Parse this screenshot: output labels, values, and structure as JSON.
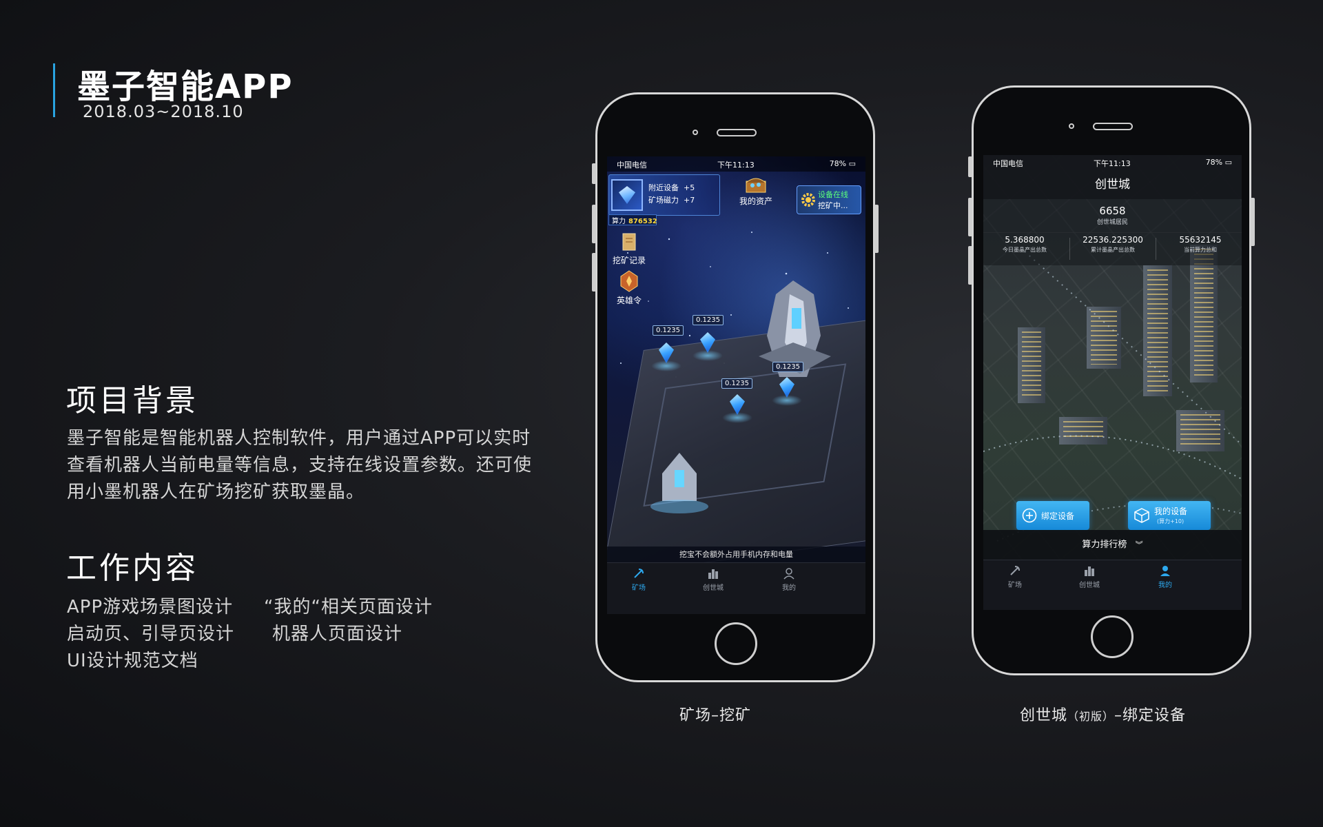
{
  "header": {
    "title": "墨子智能APP",
    "date": "2018.03~2018.10"
  },
  "background": {
    "title": "项目背景",
    "lines": [
      "墨子智能是智能机器人控制软件，用户通过APP可以实时",
      "查看机器人当前电量等信息，支持在线设置参数。还可使",
      "用小墨机器人在矿场挖矿获取墨晶。"
    ]
  },
  "work": {
    "title": "工作内容",
    "col1": [
      "APP游戏场景图设计",
      "启动页、引导页设计",
      "UI设计规范文档"
    ],
    "col2": [
      "“我的“相关页面设计",
      "机器人页面设计"
    ]
  },
  "phone1": {
    "caption": "矿场–挖矿",
    "status": {
      "carrier": "中国电信",
      "time": "下午11:13",
      "battery": "78%"
    },
    "hud": {
      "nearby": "附近设备",
      "nearby_val": "+5",
      "magnet": "矿场磁力",
      "magnet_val": "+7",
      "power_label": "算力",
      "power_val": "876532"
    },
    "assets": "我的资产",
    "online": {
      "line1": "设备在线",
      "line2": "挖矿中..."
    },
    "side": [
      "挖矿记录",
      "英雄令"
    ],
    "badges": [
      "0.1235",
      "0.1235",
      "0.1235",
      "0.1235"
    ],
    "tip": "挖宝不会额外占用手机内存和电量",
    "tabs": [
      "矿场",
      "创世城",
      "我的"
    ]
  },
  "phone2": {
    "caption_main": "创世城",
    "caption_small": "（初版）",
    "caption_tail": "–绑定设备",
    "status": {
      "carrier": "中国电信",
      "time": "下午11:13",
      "battery": "78%"
    },
    "title": "创世城",
    "residents": {
      "value": "6658",
      "label": "创世城居民"
    },
    "stats": [
      {
        "value": "5.368800",
        "label": "今日墨晶产出总数"
      },
      {
        "value": "22536.225300",
        "label": "累计墨晶产出总数"
      },
      {
        "value": "55632145",
        "label": "当前算力总和"
      }
    ],
    "bind": "绑定设备",
    "mydev": {
      "label": "我的设备",
      "sub": "(算力+10)"
    },
    "rank": "算力排行榜",
    "tabs": [
      "矿场",
      "创世城",
      "我的"
    ]
  },
  "colors": {
    "accent": "#29a3e0",
    "button": "#2da9ef",
    "gold": "#ffd93a"
  }
}
